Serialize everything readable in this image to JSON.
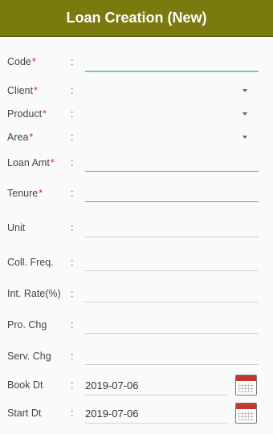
{
  "header": {
    "title": "Loan Creation (New)"
  },
  "form": {
    "colon": ":",
    "required_mark": "*",
    "code": {
      "label": "Code",
      "value": ""
    },
    "client": {
      "label": "Client",
      "value": ""
    },
    "product": {
      "label": "Product",
      "value": ""
    },
    "area": {
      "label": "Area",
      "value": ""
    },
    "loan_amt": {
      "label": "Loan Amt",
      "value": ""
    },
    "tenure": {
      "label": "Tenure",
      "value": ""
    },
    "unit": {
      "label": "Unit",
      "value": ""
    },
    "coll_freq": {
      "label": "Coll. Freq.",
      "value": ""
    },
    "int_rate": {
      "label": "Int. Rate(%)",
      "value": ""
    },
    "pro_chg": {
      "label": "Pro. Chg",
      "value": ""
    },
    "serv_chg": {
      "label": "Serv. Chg",
      "value": ""
    },
    "book_dt": {
      "label": "Book Dt",
      "value": "2019-07-06"
    },
    "start_dt": {
      "label": "Start Dt",
      "value": "2019-07-06"
    }
  },
  "icons": {
    "dropdown": "dropdown-arrow-icon",
    "calendar": "calendar-icon"
  },
  "colors": {
    "header_bg": "#7a7a0f",
    "required": "#d32f2f",
    "focus_underline": "#7fc4b8"
  }
}
